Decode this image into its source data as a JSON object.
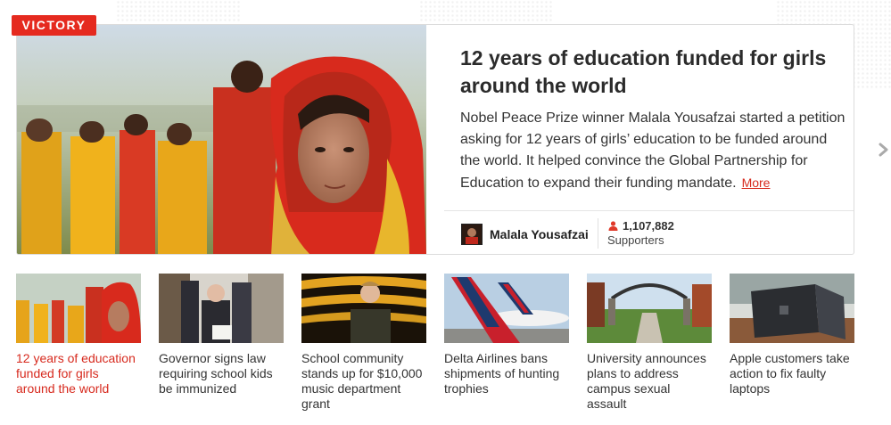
{
  "badge": "VICTORY",
  "featured": {
    "headline": "12 years of education funded for girls around the world",
    "description": "Nobel Peace Prize winner Malala Yousafzai started a petition asking for 12 years of girls’ education to be funded around the world. It helped convince the Global Partnership for Education to expand their funding mandate.",
    "more_label": "More",
    "author": "Malala Yousafzai",
    "supporters_count": "1,107,882",
    "supporters_label": "Supporters"
  },
  "cards": [
    {
      "title": "12 years of education funded for girls around the world"
    },
    {
      "title": "Governor signs law requiring school kids be immunized"
    },
    {
      "title": "School community stands up for $10,000 music department grant"
    },
    {
      "title": "Delta Airlines bans shipments of hunting trophies"
    },
    {
      "title": "University announces plans to address campus sexual assault"
    },
    {
      "title": "Apple customers take action to fix faulty laptops"
    }
  ],
  "colors": {
    "accent": "#e52a1f",
    "link": "#d72a1e"
  },
  "icons": {
    "supporters": "person-icon",
    "next": "chevron-right-icon"
  }
}
